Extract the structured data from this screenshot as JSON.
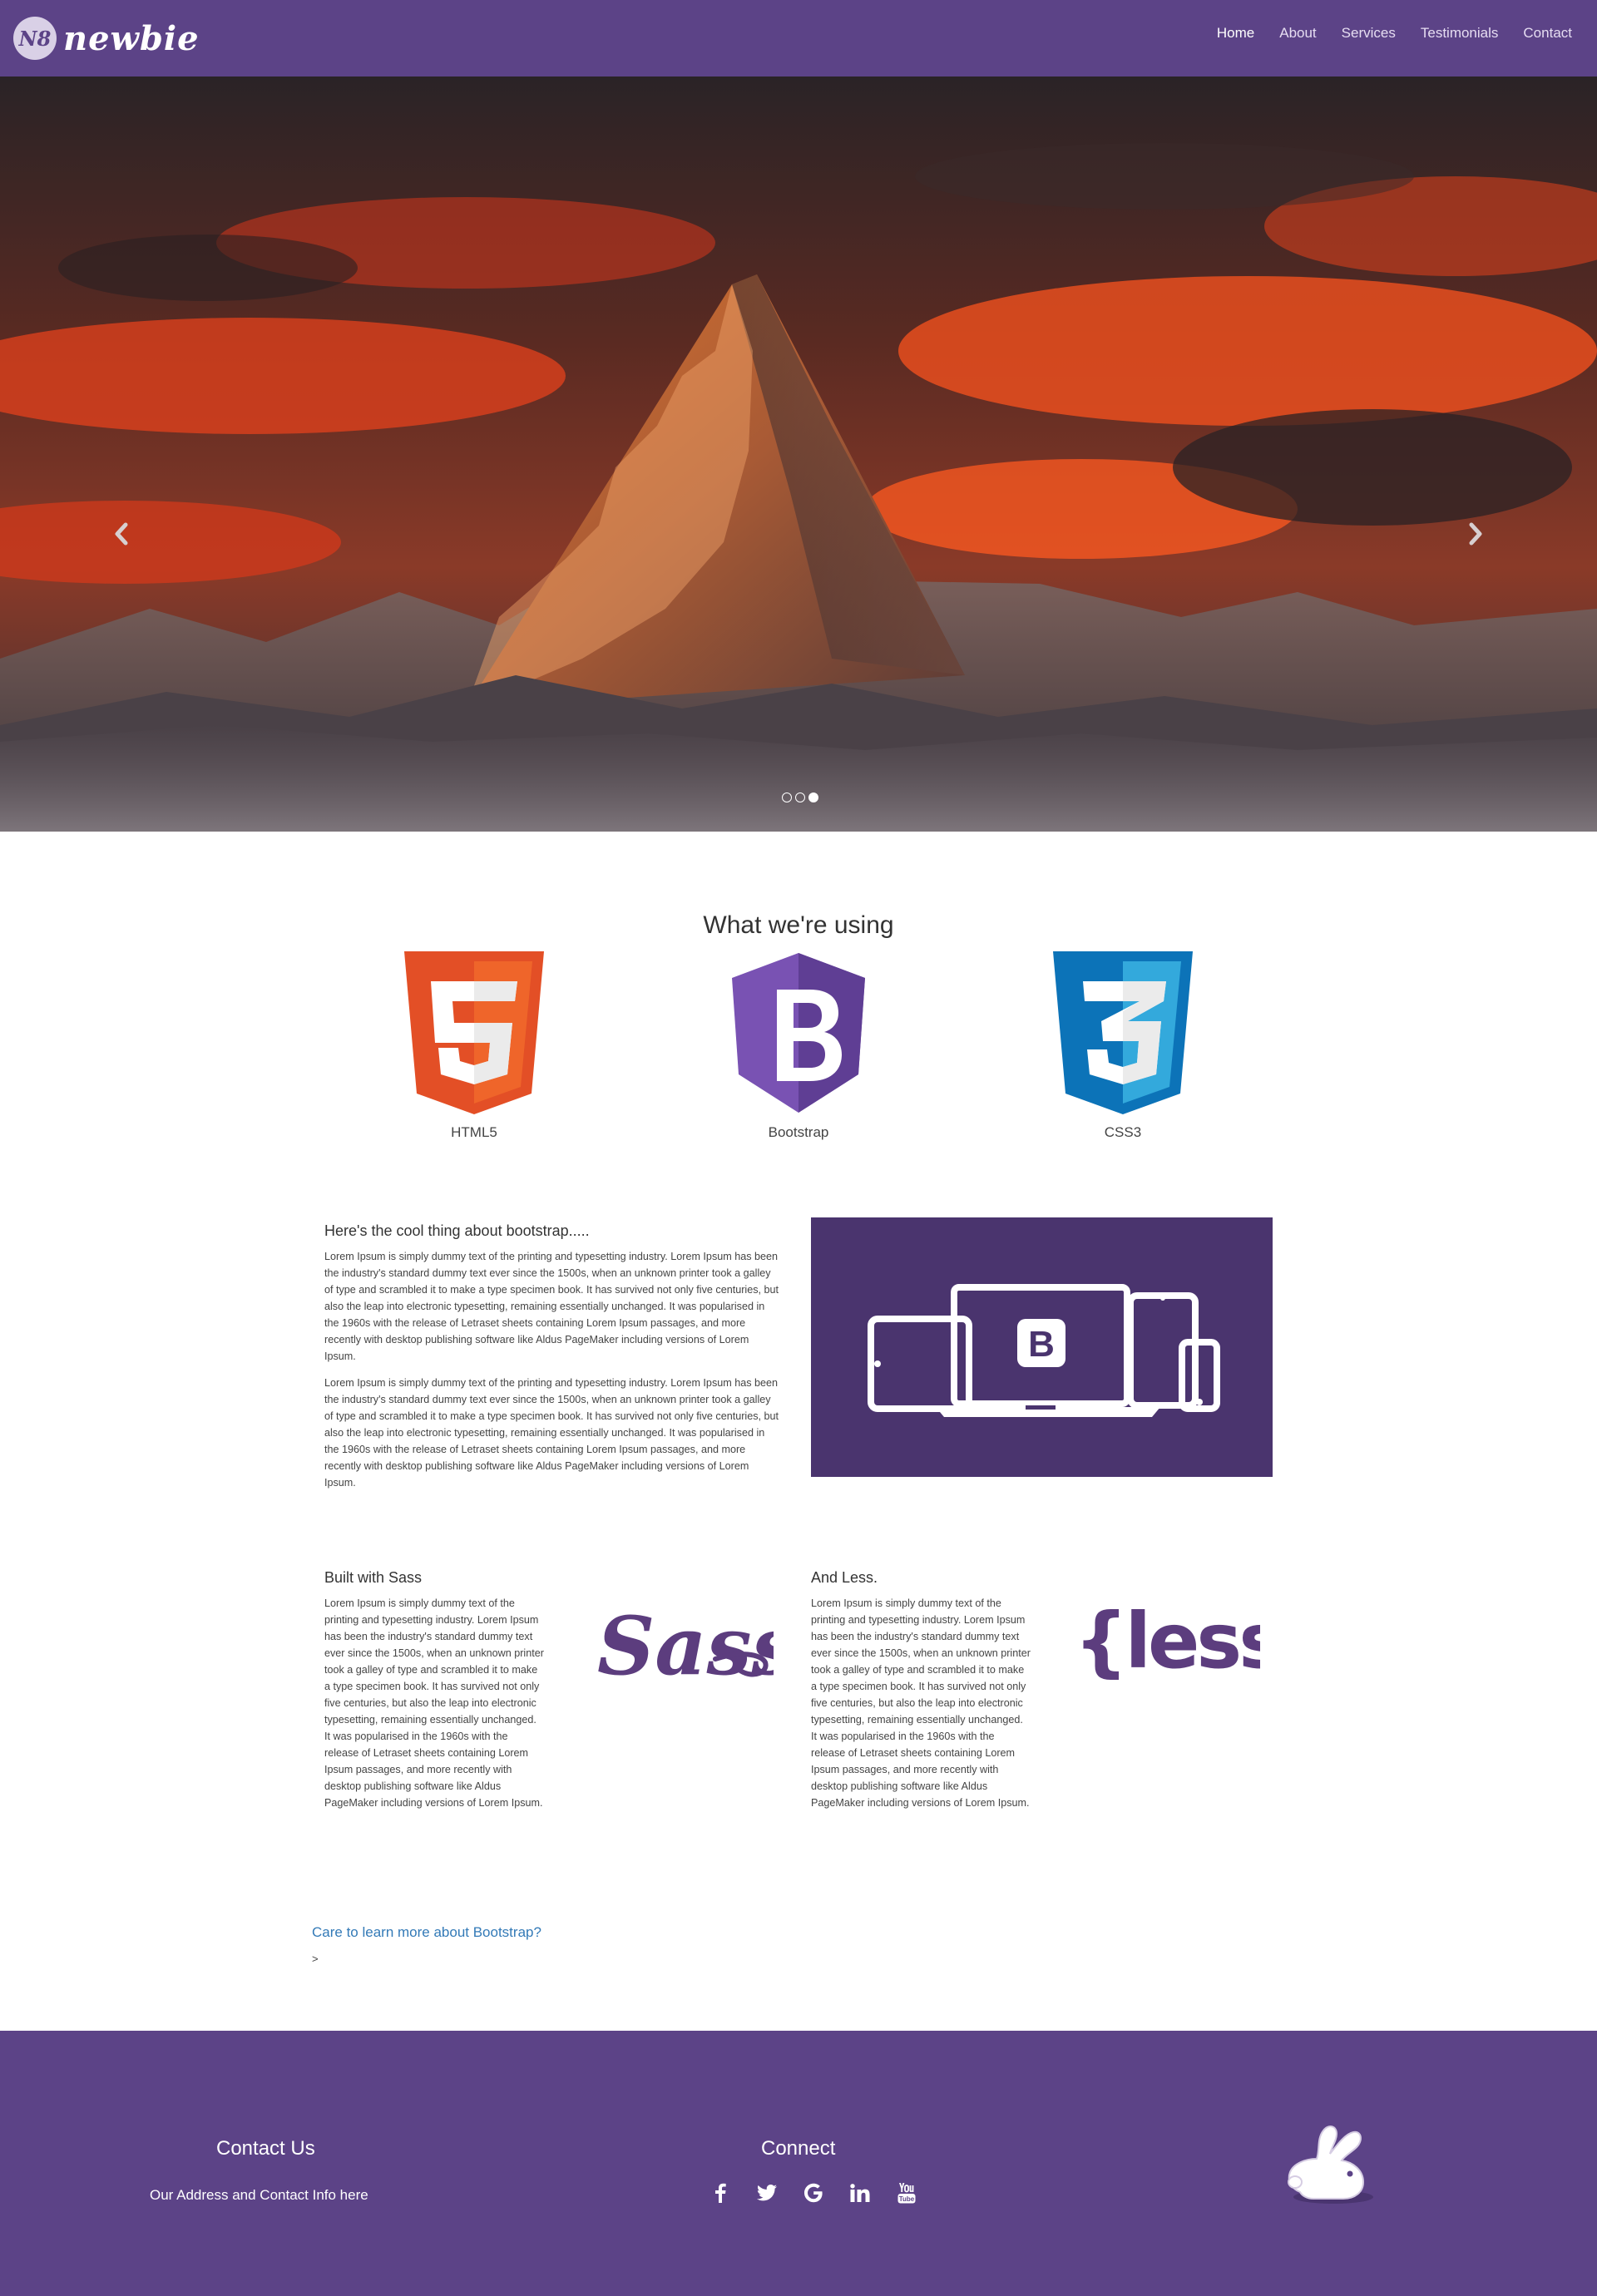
{
  "navbar": {
    "brand_mark": "N8",
    "brand": "newbie",
    "links": [
      {
        "label": "Home",
        "active": true
      },
      {
        "label": "About",
        "active": false
      },
      {
        "label": "Services",
        "active": false
      },
      {
        "label": "Testimonials",
        "active": false
      },
      {
        "label": "Contact",
        "active": false
      }
    ],
    "bg_color": "#5c4387"
  },
  "hero": {
    "image": "mountain peak at sunset with red clouds",
    "prev_icon": "chevron-left-icon",
    "next_icon": "chevron-right-icon",
    "slides_total": 3,
    "active_slide": 3
  },
  "tech": {
    "title": "What we're using",
    "items": [
      {
        "label": "HTML5",
        "icon": "html5-icon",
        "color": "#e34f26"
      },
      {
        "label": "Bootstrap",
        "icon": "bootstrap-icon",
        "color": "#7952b3"
      },
      {
        "label": "CSS3",
        "icon": "css3-icon",
        "color": "#1572b6"
      }
    ]
  },
  "about": {
    "heading": "Here's the cool thing about bootstrap.....",
    "paragraphs": [
      "Lorem Ipsum is simply dummy text of the printing and typesetting industry. Lorem Ipsum has been the industry's standard dummy text ever since the 1500s, when an unknown printer took a galley of type and scrambled it to make a type specimen book. It has survived not only five centuries, but also the leap into electronic typesetting, remaining essentially unchanged. It was popularised in the 1960s with the release of Letraset sheets containing Lorem Ipsum passages, and more recently with desktop publishing software like Aldus PageMaker including versions of Lorem Ipsum.",
      "Lorem Ipsum is simply dummy text of the printing and typesetting industry. Lorem Ipsum has been the industry's standard dummy text ever since the 1500s, when an unknown printer took a galley of type and scrambled it to make a type specimen book. It has survived not only five centuries, but also the leap into electronic typesetting, remaining essentially unchanged. It was popularised in the 1960s with the release of Letraset sheets containing Lorem Ipsum passages, and more recently with desktop publishing software like Aldus PageMaker including versions of Lorem Ipsum."
    ],
    "devices_image_bg": "#4a346e",
    "devices_logo_letter": "B"
  },
  "sass": {
    "heading": "Built with Sass",
    "text": "Lorem Ipsum is simply dummy text of the printing and typesetting industry. Lorem Ipsum has been the industry's standard dummy text ever since the 1500s, when an unknown printer took a galley of type and scrambled it to make a type specimen book. It has survived not only five centuries, but also the leap into electronic typesetting, remaining essentially unchanged. It was popularised in the 1960s with the release of Letraset sheets containing Lorem Ipsum passages, and more recently with desktop publishing software like Aldus PageMaker including versions of Lorem Ipsum.",
    "logo_text": "Sass",
    "logo_color": "#5c3d7e"
  },
  "less": {
    "heading": "And Less.",
    "text": "Lorem Ipsum is simply dummy text of the printing and typesetting industry. Lorem Ipsum has been the industry's standard dummy text ever since the 1500s, when an unknown printer took a galley of type and scrambled it to make a type specimen book. It has survived not only five centuries, but also the leap into electronic typesetting, remaining essentially unchanged. It was popularised in the 1960s with the release of Letraset sheets containing Lorem Ipsum passages, and more recently with desktop publishing software like Aldus PageMaker including versions of Lorem Ipsum.",
    "logo_text": "{less}",
    "logo_color": "#5c3d7e"
  },
  "cta": {
    "link": "Care to learn more about Bootstrap?",
    "arrow": ">"
  },
  "footer": {
    "contact_title": "Contact Us",
    "contact_info": "Our Address and Contact Info here",
    "connect_title": "Connect",
    "socials": [
      {
        "icon": "facebook-icon",
        "glyph": "f"
      },
      {
        "icon": "twitter-icon",
        "glyph": "🐦"
      },
      {
        "icon": "google-icon",
        "glyph": "G"
      },
      {
        "icon": "linkedin-icon",
        "glyph": "in"
      },
      {
        "icon": "youtube-icon",
        "glyph": "▶"
      }
    ],
    "mascot_icon": "rabbit-icon",
    "bg_color": "#5c4387"
  }
}
